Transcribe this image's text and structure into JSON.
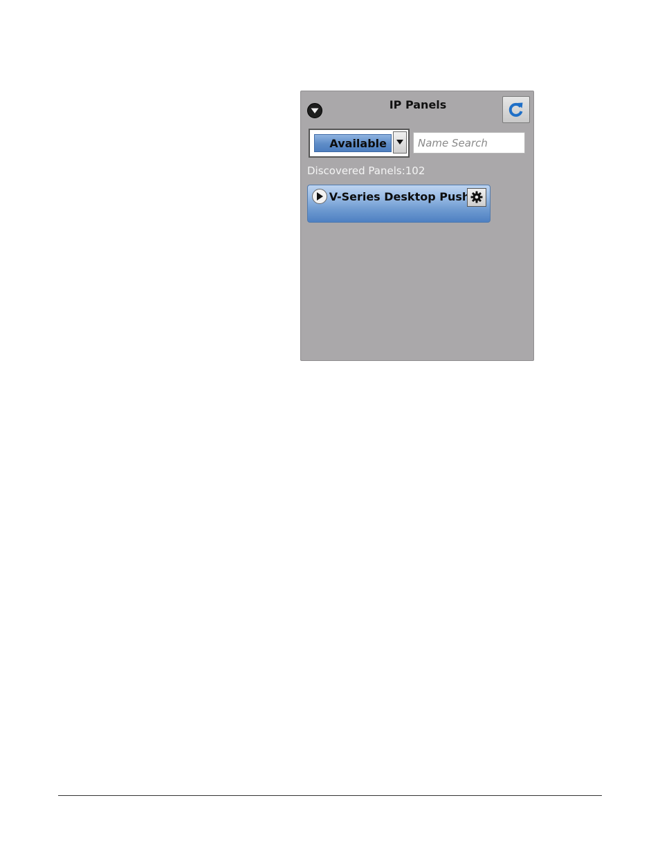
{
  "panel": {
    "title": "IP Panels",
    "filter": {
      "selected": "Available"
    },
    "search": {
      "placeholder": "Name Search",
      "value": ""
    },
    "discovered_label": "Discovered Panels:102",
    "items": [
      {
        "name": "V-Series Desktop Push"
      }
    ]
  },
  "icons": {
    "collapse": "chevron-down-circle-icon",
    "refresh": "refresh-icon",
    "dropdown": "caret-down-icon",
    "expand": "play-triangle-icon",
    "settings": "gear-icon"
  },
  "colors": {
    "panel_background": "#aaa8aa",
    "accent_blue": "#5e8cc7",
    "refresh_blue": "#1f6fc7"
  }
}
